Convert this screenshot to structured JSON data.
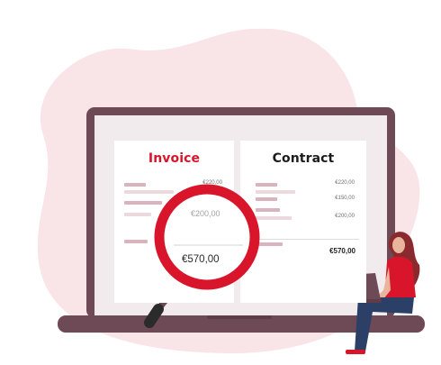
{
  "invoice": {
    "title": "Invoice",
    "amount_top": "€220,00",
    "amount_zoomed": "€200,00",
    "total": "€570,00"
  },
  "contract": {
    "title": "Contract",
    "amounts": [
      "€220,00",
      "€150,00",
      "€200,00"
    ],
    "total": "€570,00"
  },
  "colors": {
    "accent_red": "#d8152a",
    "blob_pink": "#f9e4e8",
    "laptop_dark": "#6e4a57",
    "bar_pink": "#d9b4bd"
  },
  "icons": [
    "magnifying-glass-icon",
    "laptop-illustration",
    "woman-with-laptop-illustration"
  ]
}
